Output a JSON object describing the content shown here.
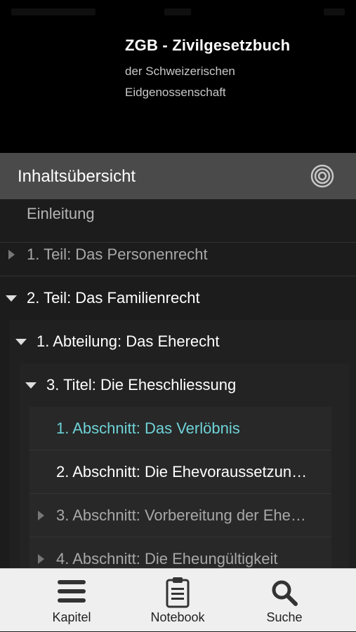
{
  "header": {
    "title": "ZGB - Zivilgesetzbuch",
    "subtitle_line1": "der Schweizerischen",
    "subtitle_line2": "Eidgenossenschaft"
  },
  "toc": {
    "title": "Inhaltsübersicht",
    "icon": "target-icon"
  },
  "items": [
    {
      "label": "Einleitung",
      "arrow": "none",
      "color": "#b4b4b4"
    },
    {
      "label": "1. Teil: Das Personenrecht",
      "arrow": "right",
      "color": "#a8a8a8"
    },
    {
      "label": "2. Teil: Das Familienrecht",
      "arrow": "down",
      "color": "#ffffff"
    },
    {
      "label": "1. Abteilung: Das Eherecht",
      "arrow": "down",
      "color": "#ffffff"
    },
    {
      "label": "3. Titel: Die Eheschliessung",
      "arrow": "down",
      "color": "#ffffff"
    },
    {
      "label": "1. Abschnitt: Das Verlöbnis",
      "arrow": "none",
      "color": "#6ed3d8"
    },
    {
      "label": "2. Abschnitt: Die Ehevoraussetzun…",
      "arrow": "none",
      "color": "#ffffff"
    },
    {
      "label": "3. Abschnitt: Vorbereitung der Ehe…",
      "arrow": "right",
      "color": "#a8a8a8"
    },
    {
      "label": "4. Abschnitt: Die Eheungültigkeit",
      "arrow": "right",
      "color": "#a8a8a8"
    }
  ],
  "tabs": [
    {
      "label": "Kapitel",
      "icon": "menu-icon"
    },
    {
      "label": "Notebook",
      "icon": "clipboard-icon"
    },
    {
      "label": "Suche",
      "icon": "search-icon"
    }
  ],
  "colors": {
    "accent": "#6ed3d8",
    "header_bg": "#000000",
    "toc_bar_bg": "#4a4a4a"
  }
}
